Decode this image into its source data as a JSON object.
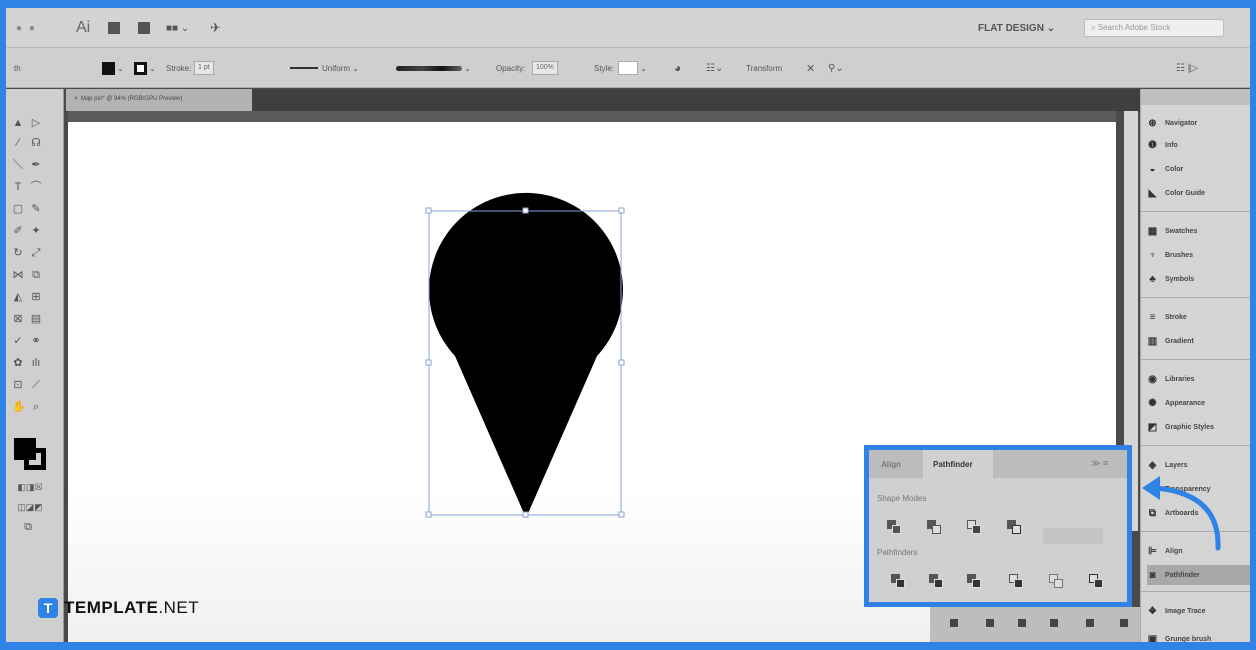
{
  "menubar": {
    "app_logo": "Ai",
    "workspace": "FLAT DESIGN",
    "search_placeholder": "Search Adobe Stock"
  },
  "controlbar": {
    "stroke_label": "Stroke:",
    "stroke_value": "1 pt",
    "profile_label": "Uniform",
    "opacity_label": "Opacity:",
    "opacity_value": "100%",
    "style_label": "Style:",
    "transform_label": "Transform"
  },
  "document": {
    "tab_title": "Map pin* @ 94% (RGB/GPU Preview)"
  },
  "dock": {
    "items": [
      {
        "label": "Navigator",
        "icon": "compass-icon"
      },
      {
        "label": "Info",
        "icon": "info-icon"
      },
      {
        "label": "Color",
        "icon": "color-icon"
      },
      {
        "label": "Color Guide",
        "icon": "color-guide-icon"
      },
      {
        "label": "Swatches",
        "icon": "swatches-icon"
      },
      {
        "label": "Brushes",
        "icon": "brush-icon"
      },
      {
        "label": "Symbols",
        "icon": "symbol-icon"
      },
      {
        "label": "Stroke",
        "icon": "stroke-icon"
      },
      {
        "label": "Gradient",
        "icon": "gradient-icon"
      },
      {
        "label": "Libraries",
        "icon": "libraries-icon"
      },
      {
        "label": "Appearance",
        "icon": "appearance-icon"
      },
      {
        "label": "Graphic Styles",
        "icon": "graphic-styles-icon"
      },
      {
        "label": "Layers",
        "icon": "layers-icon"
      },
      {
        "label": "Transparency",
        "icon": "transparency-icon"
      },
      {
        "label": "Artboards",
        "icon": "artboards-icon"
      },
      {
        "label": "Align",
        "icon": "align-icon"
      },
      {
        "label": "Pathfinder",
        "icon": "pathfinder-icon"
      },
      {
        "label": "Image Trace",
        "icon": "image-trace-icon"
      },
      {
        "label": "Grunge brush",
        "icon": "brush-library-icon"
      }
    ]
  },
  "pathfinder": {
    "tab_align": "Align",
    "tab_pathfinder": "Pathfinder",
    "shape_modes_label": "Shape Modes",
    "pathfinders_label": "Pathfinders"
  },
  "watermark": {
    "badge": "T",
    "brand_bold": "TEMPLATE",
    "brand_suffix": ".NET"
  },
  "colors": {
    "highlight": "#2f83e6",
    "shape_fill": "#000000"
  }
}
